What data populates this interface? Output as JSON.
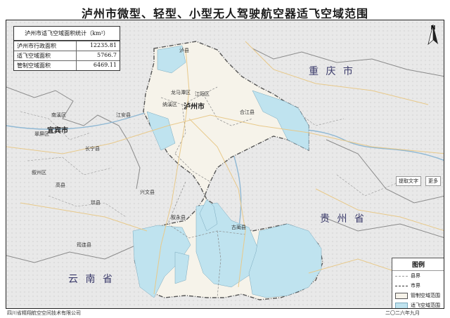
{
  "title": "泸州市微型、轻型、小型无人驾驶航空器适飞空域范围",
  "stats_table": {
    "header": "泸州市适飞空域面积统计（km²）",
    "rows": [
      {
        "label": "泸州市行政面积",
        "value": "12235.81"
      },
      {
        "label": "适飞空域面积",
        "value": "5766.7"
      },
      {
        "label": "管制空域面积",
        "value": "6469.11"
      }
    ]
  },
  "compass_label": "N",
  "regions": {
    "chongqing": "重 庆 市",
    "guizhou": "贵 州 省",
    "yunnan": "云 南 省",
    "yibin": "宜宾市",
    "luzhou": "泸州市"
  },
  "place_labels": [
    "南溪区",
    "翠屏区",
    "叙州区",
    "长宁县",
    "江安县",
    "纳溪区",
    "江阳区",
    "龙马潭区",
    "合江县",
    "泸县",
    "古蔺县",
    "叙永县",
    "兴文县",
    "珙县",
    "筠连县",
    "高县"
  ],
  "legend": {
    "title": "图例",
    "items": [
      {
        "label": "县界",
        "icon": "dashed-line",
        "color": "#9a9a9a"
      },
      {
        "label": "市界",
        "icon": "dash-dot-line",
        "color": "#333333"
      },
      {
        "label": "管制空域范围",
        "icon": "filled-box",
        "color": "#f6f3ea"
      },
      {
        "label": "适飞空域范围",
        "icon": "filled-box",
        "color": "#bfe3ef"
      }
    ]
  },
  "side_buttons": {
    "extract_text": "提取文字",
    "more": "更多"
  },
  "footer": {
    "company": "四川省精翔航空空间技术有限公司",
    "date": "二〇二六年九月"
  },
  "colors": {
    "controlled": "#f6f3ea",
    "suitable": "#bfe3ef",
    "terrain": "#e6e6e6",
    "river": "#8fb8d4",
    "road": "#e8c98a"
  }
}
